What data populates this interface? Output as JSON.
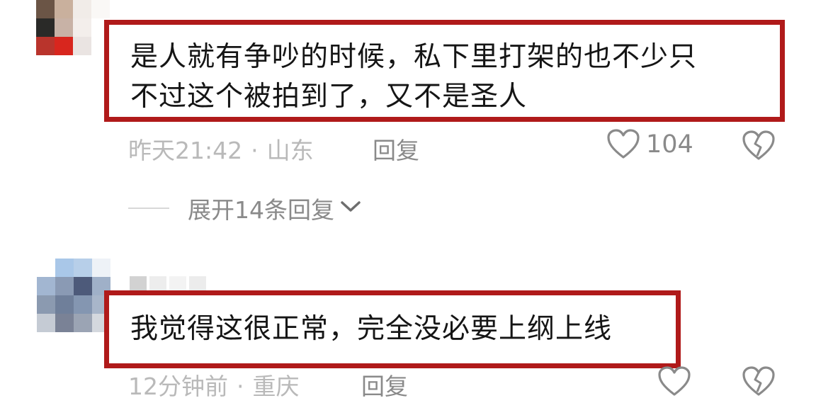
{
  "comments": [
    {
      "lines": [
        "是人就有争吵的时候，私下里打架的也不少只",
        "不过这个被拍到了，又不是圣人"
      ],
      "time": "昨天21:42",
      "location": "山东",
      "separator": "·",
      "reply_label": "回复",
      "like_count": "104",
      "like_icon": "heart-outline-icon",
      "dislike_icon": "broken-heart-icon",
      "highlight_color": "#b01a1a"
    },
    {
      "lines": [
        "我觉得这很正常，完全没必要上纲上线"
      ],
      "time": "12分钟前",
      "location": "重庆",
      "separator": "·",
      "reply_label": "回复",
      "like_count": "",
      "like_icon": "heart-outline-icon",
      "dislike_icon": "broken-heart-icon",
      "highlight_color": "#b01a1a"
    }
  ],
  "expand_replies": {
    "label": "展开14条回复",
    "icon": "chevron-down-icon"
  }
}
